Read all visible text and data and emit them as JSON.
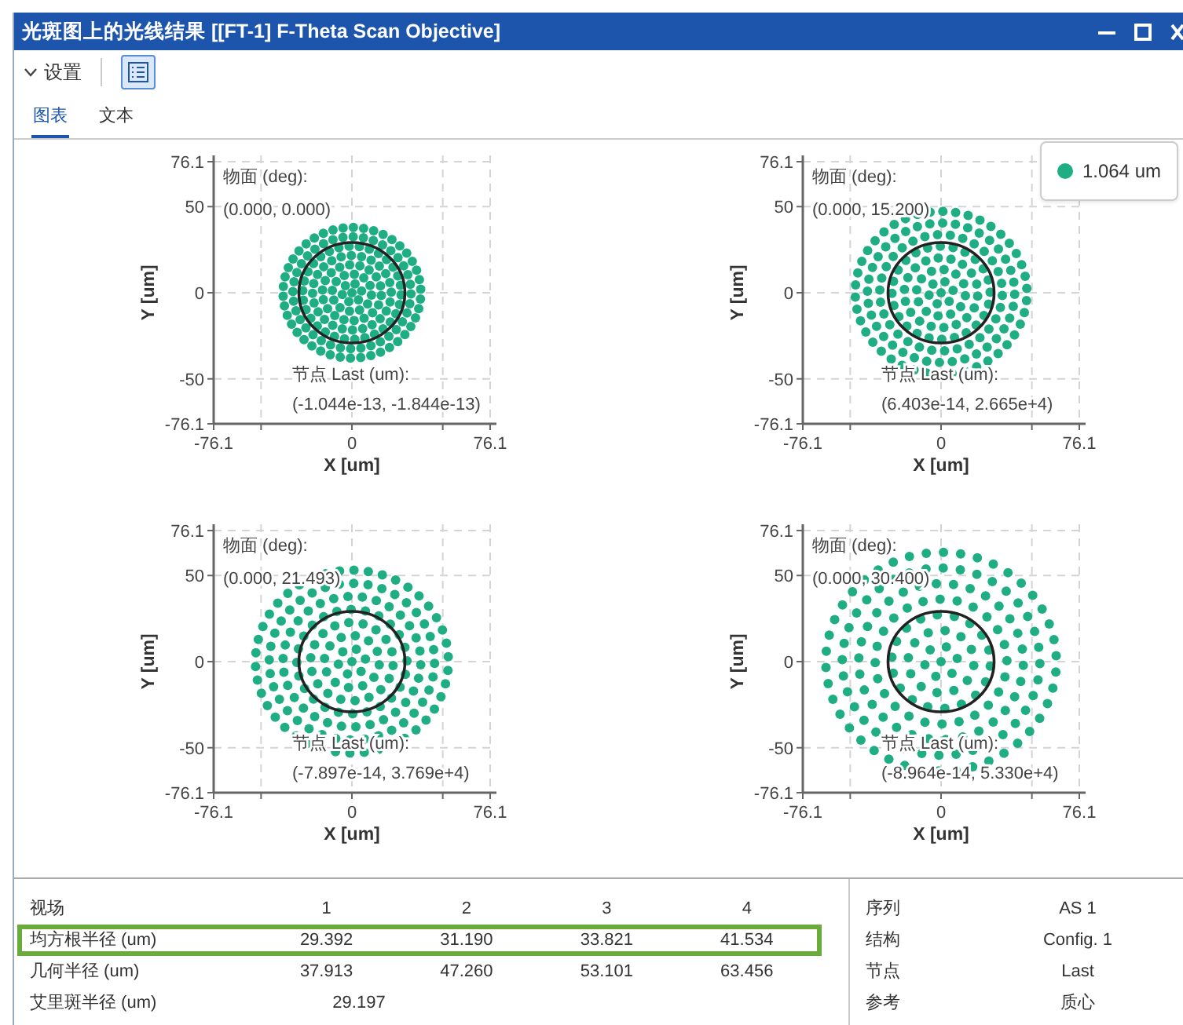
{
  "window": {
    "title": "光斑图上的光线结果 [[FT-1] F-Theta Scan Objective]"
  },
  "toolbar": {
    "settings_label": "设置"
  },
  "tabs": [
    {
      "label": "图表",
      "selected": true
    },
    {
      "label": "文本",
      "selected": false
    }
  ],
  "legend": {
    "label": "1.064 um",
    "color": "#1fae84"
  },
  "plots": [
    {
      "object_label": "物面 (deg):",
      "object_value": "(0.000, 0.000)",
      "node_label": "节点 Last (um):",
      "node_value": "(-1.044e-13, -1.844e-13)",
      "xlabel": "X [um]",
      "ylabel": "Y [um]",
      "xticks": [
        "-76.1",
        "0",
        "76.1"
      ],
      "yticks": [
        "76.1",
        "50",
        "0",
        "-50",
        "-76.1"
      ]
    },
    {
      "object_label": "物面 (deg):",
      "object_value": "(0.000, 15.200)",
      "node_label": "节点 Last (um):",
      "node_value": "(6.403e-14, 2.665e+4)",
      "xlabel": "X [um]",
      "ylabel": "Y [um]",
      "xticks": [
        "-76.1",
        "0",
        "76.1"
      ],
      "yticks": [
        "76.1",
        "50",
        "0",
        "-50",
        "-76.1"
      ]
    },
    {
      "object_label": "物面 (deg):",
      "object_value": "(0.000, 21.493)",
      "node_label": "节点 Last (um):",
      "node_value": "(-7.897e-14, 3.769e+4)",
      "xlabel": "X [um]",
      "ylabel": "Y [um]",
      "xticks": [
        "-76.1",
        "0",
        "76.1"
      ],
      "yticks": [
        "76.1",
        "50",
        "0",
        "-50",
        "-76.1"
      ]
    },
    {
      "object_label": "物面 (deg):",
      "object_value": "(0.000, 30.400)",
      "node_label": "节点 Last (um):",
      "node_value": "(-8.964e-14, 5.330e+4)",
      "xlabel": "X [um]",
      "ylabel": "Y [um]",
      "xticks": [
        "-76.1",
        "0",
        "76.1"
      ],
      "yticks": [
        "76.1",
        "50",
        "0",
        "-50",
        "-76.1"
      ]
    }
  ],
  "table": {
    "columns": [
      "视场",
      "1",
      "2",
      "3",
      "4"
    ],
    "rows": [
      {
        "cells": [
          "均方根半径 (um)",
          "29.392",
          "31.190",
          "33.821",
          "41.534"
        ],
        "highlighted": true
      },
      {
        "cells": [
          "几何半径 (um)",
          "37.913",
          "47.260",
          "53.101",
          "63.456"
        ],
        "highlighted": false
      },
      {
        "cells": [
          "艾里斑半径 (um)",
          "29.197"
        ],
        "highlighted": false
      }
    ]
  },
  "info": [
    {
      "label": "序列",
      "value": "AS 1"
    },
    {
      "label": "结构",
      "value": "Config. 1"
    },
    {
      "label": "节点",
      "value": "Last"
    },
    {
      "label": "参考",
      "value": "质心"
    }
  ]
}
